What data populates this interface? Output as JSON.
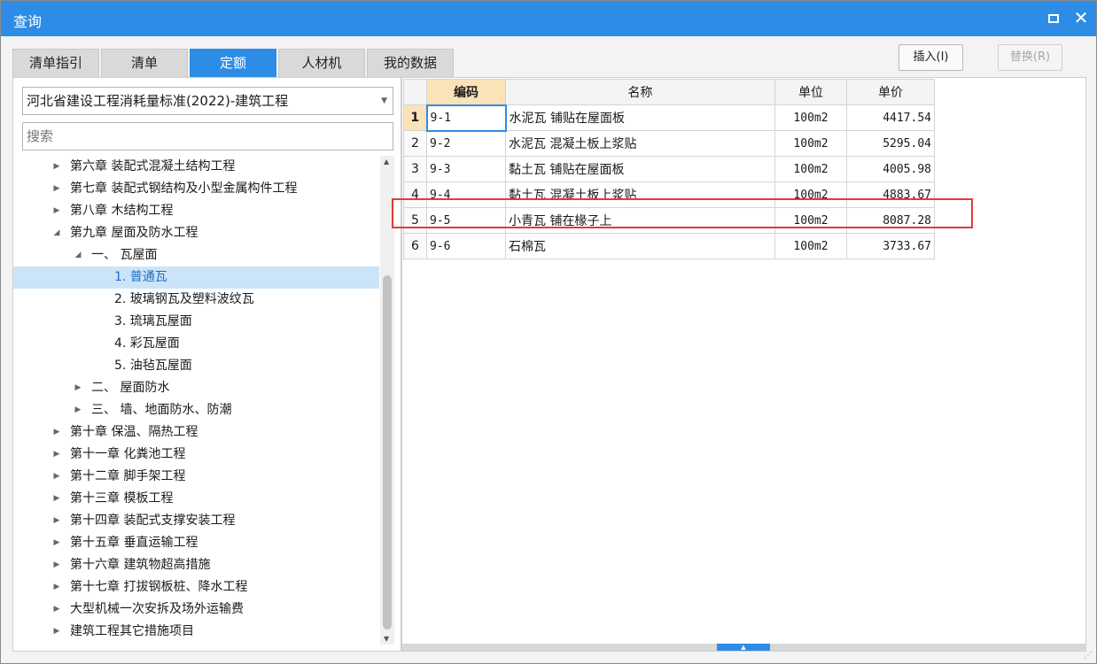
{
  "window": {
    "title": "查询"
  },
  "tabs": [
    "清单指引",
    "清单",
    "定额",
    "人材机",
    "我的数据"
  ],
  "actions": {
    "insert_label": "插入(I)",
    "replace_label": "替换(R)"
  },
  "left": {
    "selected_standard": "河北省建设工程消耗量标准(2022)-建筑工程",
    "search_placeholder": "搜索"
  },
  "tree": [
    {
      "label": "第六章 装配式混凝土结构工程",
      "state": "collapsed"
    },
    {
      "label": "第七章 装配式钢结构及小型金属构件工程",
      "state": "collapsed"
    },
    {
      "label": "第八章 木结构工程",
      "state": "collapsed"
    },
    {
      "label": "第九章 屋面及防水工程",
      "state": "expanded"
    },
    {
      "label": "一、 瓦屋面",
      "state": "expanded"
    },
    {
      "label": "1. 普通瓦",
      "state": "leaf",
      "selected": true
    },
    {
      "label": "2. 玻璃钢瓦及塑料波纹瓦",
      "state": "leaf"
    },
    {
      "label": "3. 琉璃瓦屋面",
      "state": "leaf"
    },
    {
      "label": "4. 彩瓦屋面",
      "state": "leaf"
    },
    {
      "label": "5. 油毡瓦屋面",
      "state": "leaf"
    },
    {
      "label": "二、 屋面防水",
      "state": "collapsed"
    },
    {
      "label": "三、 墙、地面防水、防潮",
      "state": "collapsed"
    },
    {
      "label": "第十章 保温、隔热工程",
      "state": "collapsed"
    },
    {
      "label": "第十一章 化粪池工程",
      "state": "collapsed"
    },
    {
      "label": "第十二章 脚手架工程",
      "state": "collapsed"
    },
    {
      "label": "第十三章 模板工程",
      "state": "collapsed"
    },
    {
      "label": "第十四章 装配式支撑安装工程",
      "state": "collapsed"
    },
    {
      "label": "第十五章 垂直运输工程",
      "state": "collapsed"
    },
    {
      "label": "第十六章 建筑物超高措施",
      "state": "collapsed"
    },
    {
      "label": "第十七章 打拔钢板桩、降水工程",
      "state": "collapsed"
    },
    {
      "label": "大型机械一次安拆及场外运输费",
      "state": "collapsed"
    },
    {
      "label": "建筑工程其它措施项目",
      "state": "collapsed"
    }
  ],
  "grid": {
    "columns": [
      "编码",
      "名称",
      "单位",
      "单价"
    ],
    "rows": [
      {
        "no": "1",
        "code": "9-1",
        "name": "水泥瓦 铺贴在屋面板",
        "unit": "100m2",
        "price": "4417.54"
      },
      {
        "no": "2",
        "code": "9-2",
        "name": "水泥瓦 混凝土板上浆贴",
        "unit": "100m2",
        "price": "5295.04"
      },
      {
        "no": "3",
        "code": "9-3",
        "name": "黏土瓦 铺贴在屋面板",
        "unit": "100m2",
        "price": "4005.98"
      },
      {
        "no": "4",
        "code": "9-4",
        "name": "黏土瓦 混凝土板上浆贴",
        "unit": "100m2",
        "price": "4883.67"
      },
      {
        "no": "5",
        "code": "9-5",
        "name": "小青瓦 铺在椽子上",
        "unit": "100m2",
        "price": "8087.28"
      },
      {
        "no": "6",
        "code": "9-6",
        "name": "石棉瓦",
        "unit": "100m2",
        "price": "3733.67"
      }
    ]
  }
}
